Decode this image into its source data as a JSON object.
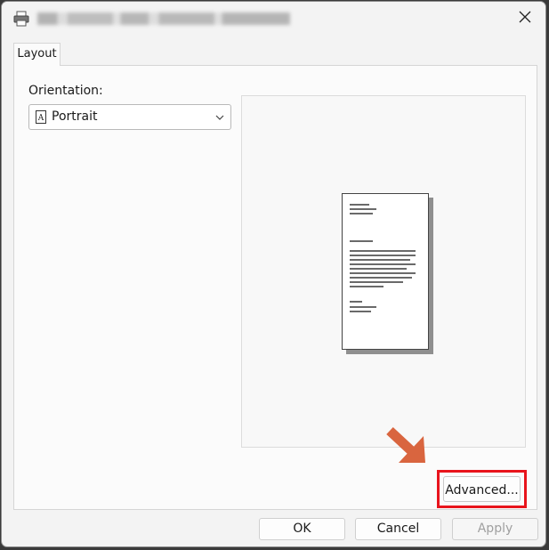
{
  "window": {
    "title": "",
    "title_obscured": true
  },
  "icons": {
    "app": "printer-icon",
    "close": "close-icon",
    "orientation": "portrait-page-icon",
    "dropdown": "chevron-down-icon",
    "annotation": "arrow-pointer-annotation"
  },
  "tabs": [
    {
      "label": "Layout",
      "selected": true
    }
  ],
  "layout": {
    "orientation_label": "Orientation:",
    "orientation_select": {
      "value": "Portrait"
    }
  },
  "advanced_button": {
    "label": "Advanced..."
  },
  "buttons": {
    "ok": "OK",
    "cancel": "Cancel",
    "apply": "Apply",
    "apply_disabled": true
  },
  "colors": {
    "highlight_box": "#e8141c",
    "annotation_arrow": "#d9653f",
    "dialog_bg": "#f3f3f3",
    "panel_bg": "#fbfbfb"
  }
}
